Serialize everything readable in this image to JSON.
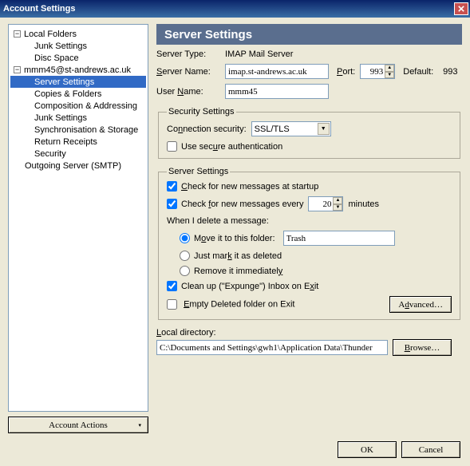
{
  "window": {
    "title": "Account Settings"
  },
  "sidebar": {
    "items": [
      {
        "label": "Local Folders",
        "level": 0,
        "toggle": "−"
      },
      {
        "label": "Junk Settings",
        "level": 2
      },
      {
        "label": "Disc Space",
        "level": 2
      },
      {
        "label": "mmm45@st-andrews.ac.uk",
        "level": 0,
        "toggle": "−"
      },
      {
        "label": "Server Settings",
        "level": 2,
        "selected": true
      },
      {
        "label": "Copies & Folders",
        "level": 2
      },
      {
        "label": "Composition & Addressing",
        "level": 2
      },
      {
        "label": "Junk Settings",
        "level": 2
      },
      {
        "label": "Synchronisation & Storage",
        "level": 2
      },
      {
        "label": "Return Receipts",
        "level": 2
      },
      {
        "label": "Security",
        "level": 2
      },
      {
        "label": "Outgoing Server (SMTP)",
        "level": 1
      }
    ]
  },
  "accountActions": "Account Actions",
  "heading": "Server Settings",
  "serverType": {
    "label": "Server Type:",
    "value": "IMAP Mail Server"
  },
  "serverName": {
    "label": "Server Name:",
    "value": "imap.st-andrews.ac.uk"
  },
  "port": {
    "label": "Port:",
    "value": "993"
  },
  "defaultLabel": "Default:",
  "defaultValue": "993",
  "userName": {
    "label": "User Name:",
    "value": "mmm45"
  },
  "security": {
    "legend": "Security Settings",
    "connSecLabel": "Connection security:",
    "connSecValue": "SSL/TLS",
    "secureAuth": "Use secure authentication"
  },
  "serverSettings": {
    "legend": "Server Settings",
    "checkStartup": "Check for new messages at startup",
    "checkEveryPre": "Check for new messages every",
    "checkEveryValue": "20",
    "checkEveryPost": "minutes",
    "deleteLabel": "When I delete a message:",
    "moveTo": "Move it to this folder:",
    "trashValue": "Trash",
    "justMark": "Just mark it as deleted",
    "removeImm": "Remove it immediately",
    "expunge": "Clean up (\"Expunge\") Inbox on Exit",
    "emptyDeleted": "Empty Deleted folder on Exit",
    "advanced": "Advanced…"
  },
  "localDir": {
    "label": "Local directory:",
    "value": "C:\\Documents and Settings\\gwh1\\Application Data\\Thunder",
    "browse": "Browse…"
  },
  "buttons": {
    "ok": "OK",
    "cancel": "Cancel"
  }
}
